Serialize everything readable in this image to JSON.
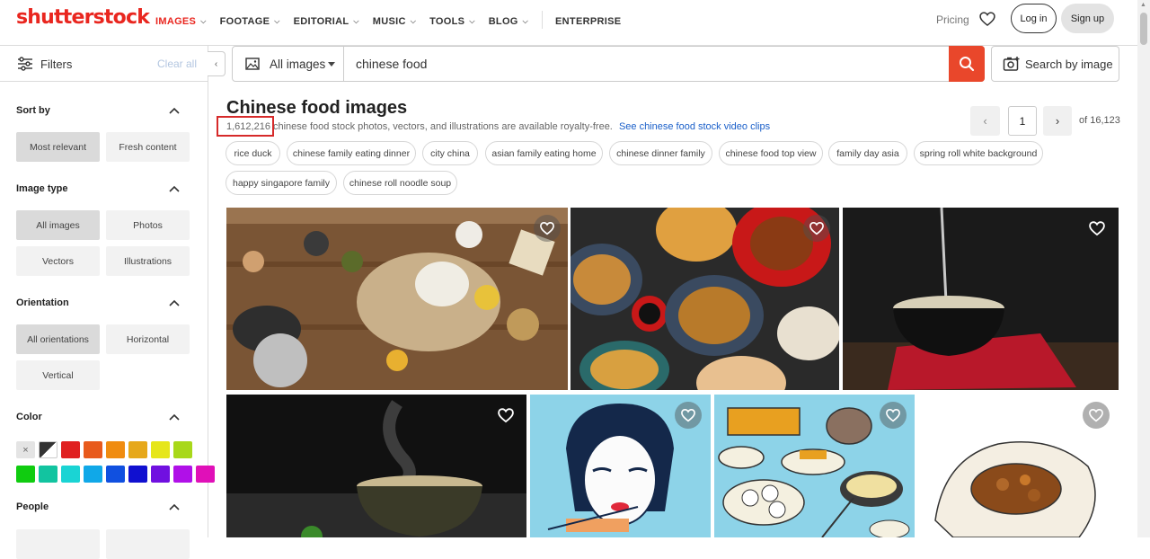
{
  "header": {
    "logo": "shutterstock",
    "nav": [
      {
        "label": "IMAGES",
        "has_menu": true,
        "active": true
      },
      {
        "label": "FOOTAGE",
        "has_menu": true
      },
      {
        "label": "EDITORIAL",
        "has_menu": true
      },
      {
        "label": "MUSIC",
        "has_menu": true
      },
      {
        "label": "TOOLS",
        "has_menu": true
      },
      {
        "label": "BLOG",
        "has_menu": true
      },
      {
        "label": "ENTERPRISE",
        "has_menu": false
      }
    ],
    "pricing": "Pricing",
    "login": "Log in",
    "signup": "Sign up"
  },
  "sidebar": {
    "filters_label": "Filters",
    "clear_all": "Clear all",
    "collapse_glyph": "‹",
    "sections": {
      "sort_by": {
        "title": "Sort by",
        "options": [
          "Most relevant",
          "Fresh content"
        ],
        "selected": "Most relevant"
      },
      "image_type": {
        "title": "Image type",
        "options": [
          "All images",
          "Photos",
          "Vectors",
          "Illustrations"
        ],
        "selected": "All images"
      },
      "orientation": {
        "title": "Orientation",
        "options": [
          "All orientations",
          "Horizontal",
          "Vertical"
        ],
        "selected": "All orientations"
      },
      "color": {
        "title": "Color",
        "clear_glyph": "×"
      },
      "people": {
        "title": "People"
      }
    }
  },
  "search": {
    "type_label": "All images",
    "query": "chinese food",
    "search_by_image": "Search by image"
  },
  "results": {
    "title": "Chinese food images",
    "count": "1,612,216",
    "subtitle_rest": "chinese food stock photos, vectors, and illustrations are available royalty-free.",
    "video_link": "See chinese food stock video clips",
    "tags": [
      "rice duck",
      "chinese family eating dinner",
      "city china",
      "asian family eating home",
      "chinese dinner family",
      "chinese food top view",
      "family day asia",
      "spring roll white background",
      "happy singapore family",
      "chinese roll noodle soup"
    ]
  },
  "pager": {
    "prev": "‹",
    "page": "1",
    "next": "›",
    "of": "of 16,123"
  },
  "colors": {
    "accent": "#e9261f",
    "search_button": "#e9472b",
    "link": "#1a5fc9",
    "swatches": [
      "#e8e8e8",
      "#333333",
      "#e02020",
      "#e85a1c",
      "#f08c10",
      "#e6a81a",
      "#e6e61a",
      "#a8d81a",
      "#10cc10",
      "#12c4a0",
      "#1ad4d4",
      "#10a8e8",
      "#1050e0",
      "#1010d0",
      "#7010e0",
      "#b010e8",
      "#e010b8"
    ]
  },
  "icons": {
    "filters": "sliders-icon",
    "search": "search-icon",
    "image_type": "image-icon",
    "search_by_image": "camera-search-icon",
    "favorite": "heart-icon",
    "collapse": "chevron-up-icon"
  }
}
